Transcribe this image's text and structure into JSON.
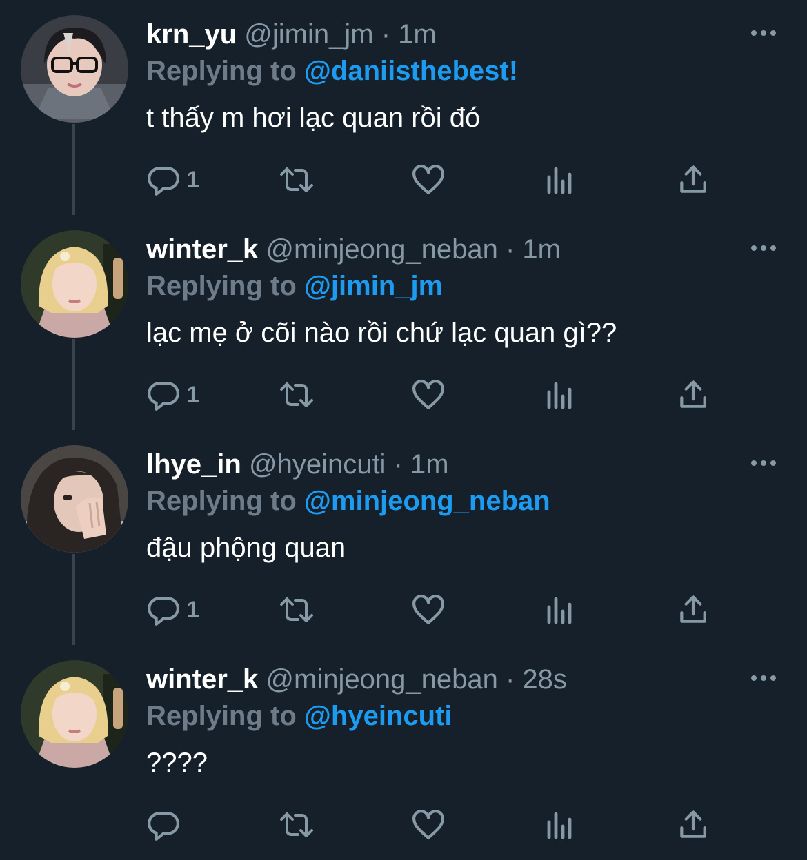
{
  "colors": {
    "background": "#15202b",
    "text": "#ffffff",
    "secondary": "#8899a6",
    "mention": "#1d9bf0",
    "thread_line": "#38444d"
  },
  "tweets": [
    {
      "name": "krn_yu",
      "handle": "@jimin_jm",
      "separator": "·",
      "time": "1m",
      "replying_label": "Replying to",
      "replying_to": "@daniisthebest!",
      "text": "t thấy m hơi lạc quan rồi đó",
      "reply_count": "1",
      "avatar_icon": "avatar-dark-hair-glasses"
    },
    {
      "name": "winter_k",
      "handle": "@minjeong_neban",
      "separator": "·",
      "time": "1m",
      "replying_label": "Replying to",
      "replying_to": "@jimin_jm",
      "text": "lạc mẹ ở cõi nào rồi chứ lạc quan gì??",
      "reply_count": "1",
      "avatar_icon": "avatar-blonde-hair"
    },
    {
      "name": "lhye_in",
      "handle": "@hyeincuti",
      "separator": "·",
      "time": "1m",
      "replying_label": "Replying to",
      "replying_to": "@minjeong_neban",
      "text": "đậu phộng quan",
      "reply_count": "1",
      "avatar_icon": "avatar-dark-hair-hand"
    },
    {
      "name": "winter_k",
      "handle": "@minjeong_neban",
      "separator": "·",
      "time": "28s",
      "replying_label": "Replying to",
      "replying_to": "@hyeincuti",
      "text": "????",
      "reply_count": "",
      "avatar_icon": "avatar-blonde-hair"
    }
  ]
}
